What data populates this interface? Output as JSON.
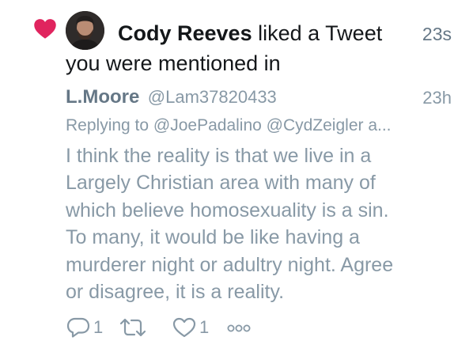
{
  "notification": {
    "user_name": "Cody Reeves",
    "action_text": "liked a Tweet",
    "action_text_line2": "you were mentioned in",
    "time": "23s"
  },
  "tweet": {
    "author_name": "L.Moore",
    "author_handle": "@Lam37820433",
    "time": "23h",
    "replying_to": "Replying to @JoePadalino @CydZeigler a...",
    "body_lines": [
      "I think the reality is that we live in a",
      "Largely Christian area with many of",
      "which believe homosexuality is a sin.",
      "To many, it would be like having a",
      "murderer night or adultry night. Agree",
      "or disagree, it is a reality."
    ],
    "reply_count": "1",
    "retweet_count": "",
    "like_count": "1"
  },
  "icons": {
    "notification_icon": "heart-icon",
    "reply": "reply-icon",
    "retweet": "retweet-icon",
    "like": "like-icon",
    "more": "more-icon"
  },
  "colors": {
    "heart": "#e0245e",
    "text_primary": "#14171a",
    "text_muted": "#8899a6",
    "text_time": "#657786"
  }
}
